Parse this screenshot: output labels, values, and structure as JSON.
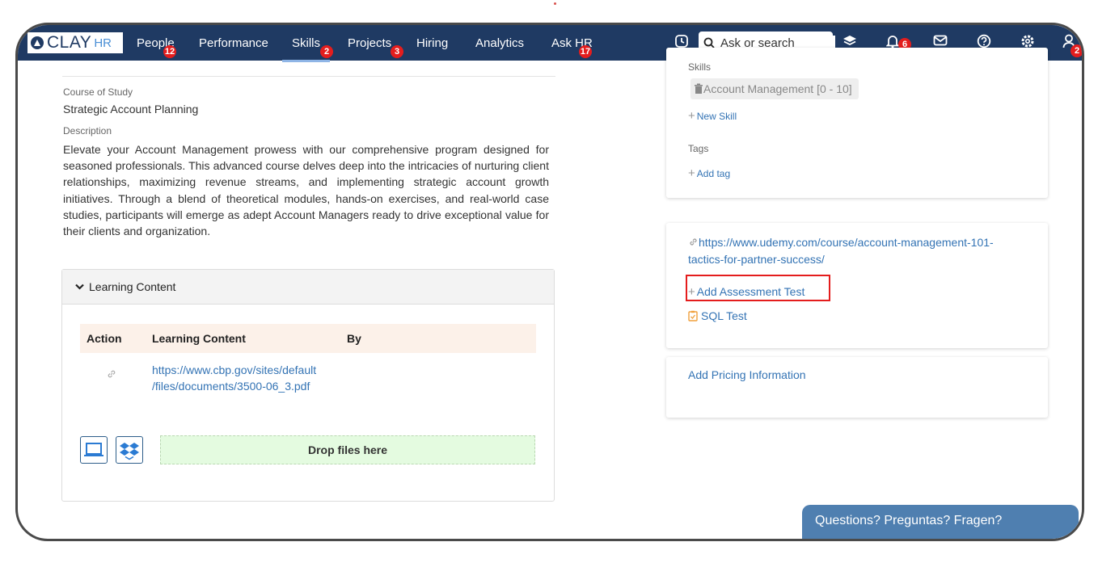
{
  "brand": {
    "name_main": "CLAY",
    "name_sub": "HR"
  },
  "nav": {
    "items": [
      {
        "label": "People",
        "badge": "12"
      },
      {
        "label": "Performance",
        "badge": ""
      },
      {
        "label": "Skills",
        "badge": "2"
      },
      {
        "label": "Projects",
        "badge": "3"
      },
      {
        "label": "Hiring",
        "badge": ""
      },
      {
        "label": "Analytics",
        "badge": ""
      },
      {
        "label": "Ask HR",
        "badge": "17"
      }
    ],
    "active": "Skills",
    "search_placeholder": "Ask or search",
    "notifications_badge": "6",
    "profile_badge": "2",
    "icons": [
      "clock-icon",
      "layers-icon",
      "bell-icon",
      "mail-icon",
      "help-icon",
      "gear-icon",
      "user-icon"
    ]
  },
  "course": {
    "course_of_study_label": "Course of Study",
    "course_of_study": "Strategic Account Planning",
    "description_label": "Description",
    "description": "Elevate your Account Management prowess with our comprehensive program designed for seasoned professionals. This advanced course delves deep into the intricacies of nurturing client relationships, maximizing revenue streams, and implementing strategic account growth initiatives. Through a blend of theoretical modules, hands-on exercises, and real-world case studies, participants will emerge as adept Account Managers ready to drive exceptional value for their clients and organization."
  },
  "learning_content": {
    "title": "Learning Content",
    "columns": [
      "Action",
      "Learning Content",
      "By"
    ],
    "rows": [
      {
        "link_line1": "https://www.cbp.gov/sites/default",
        "link_line2": "/files/documents/3500-06_3.pdf",
        "by": ""
      }
    ],
    "drop_label": "Drop files here"
  },
  "skills_card": {
    "skills_label": "Skills",
    "skill": "Account Management  [0 - 10]",
    "new_skill": "New Skill",
    "tags_label": "Tags",
    "add_tag": "Add tag"
  },
  "links_card": {
    "url_line1": "https://www.udemy.com/course/account-management-101-",
    "url_line2": "tactics-for-partner-success/",
    "add_assessment": "Add Assessment Test",
    "test": "SQL Test"
  },
  "pricing_card": {
    "label": "Add Pricing Information"
  },
  "chat": {
    "label": "Questions? Preguntas? Fragen?"
  },
  "colors": {
    "nav_bg": "#1f3a63",
    "link": "#3373b4",
    "badge": "#e41d1d",
    "drop_bg": "#e4fbe0",
    "chat_bg": "#4f7fb0"
  }
}
